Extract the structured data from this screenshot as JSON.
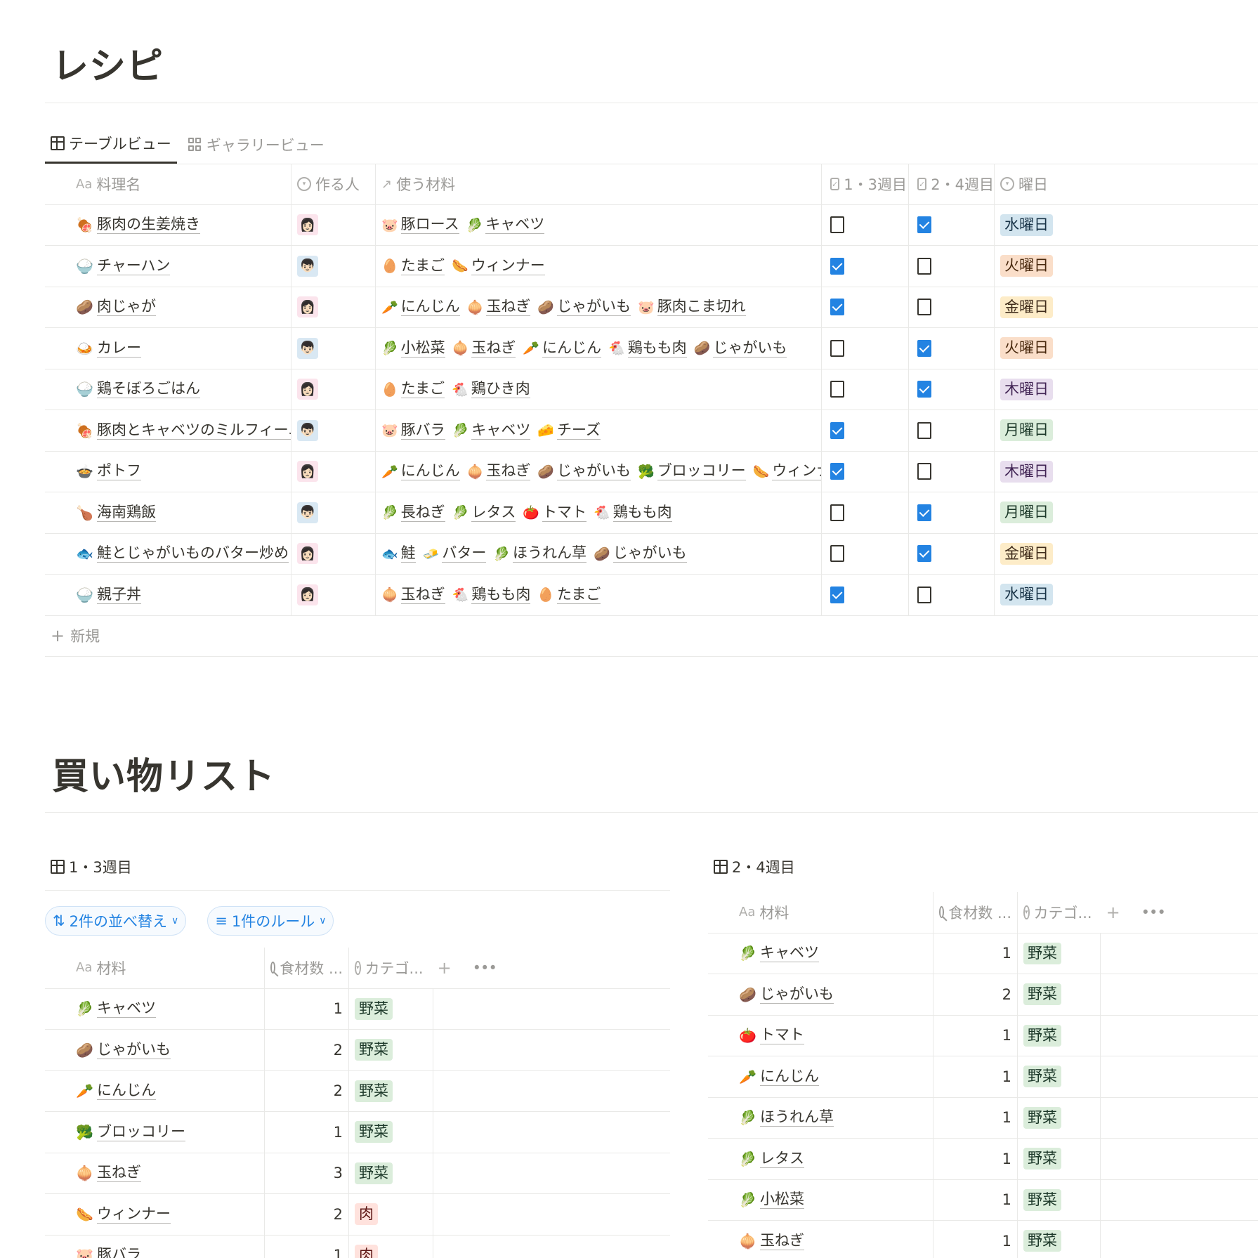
{
  "recipes": {
    "title": "レシピ",
    "tabs": [
      {
        "label": "テーブルビュー",
        "icon": "table-icon",
        "active": true
      },
      {
        "label": "ギャラリービュー",
        "icon": "gallery-icon",
        "active": false
      }
    ],
    "columns": {
      "name": {
        "icon": "Aa",
        "label": "料理名"
      },
      "cook": {
        "label": "作る人"
      },
      "ingredients": {
        "icon": "↗",
        "label": "使う材料"
      },
      "week13": {
        "label": "1・3週目"
      },
      "week24": {
        "label": "2・4週目"
      },
      "day": {
        "label": "曜日"
      }
    },
    "new_label": "新規",
    "rows": [
      {
        "emoji": "🍖",
        "name": "豚肉の生姜焼き",
        "cook": "f",
        "ingredients": [
          [
            "🐷",
            "豚ロース"
          ],
          [
            "🥬",
            "キャベツ"
          ]
        ],
        "w13": false,
        "w24": true,
        "day": "水曜日"
      },
      {
        "emoji": "🍚",
        "name": "チャーハン",
        "cook": "m",
        "ingredients": [
          [
            "🥚",
            "たまご"
          ],
          [
            "🌭",
            "ウィンナー"
          ]
        ],
        "w13": true,
        "w24": false,
        "day": "火曜日"
      },
      {
        "emoji": "🥔",
        "name": "肉じゃが",
        "cook": "f",
        "ingredients": [
          [
            "🥕",
            "にんじん"
          ],
          [
            "🧅",
            "玉ねぎ"
          ],
          [
            "🥔",
            "じゃがいも"
          ],
          [
            "🐷",
            "豚肉こま切れ"
          ]
        ],
        "w13": true,
        "w24": false,
        "day": "金曜日"
      },
      {
        "emoji": "🍛",
        "name": "カレー",
        "cook": "m",
        "ingredients": [
          [
            "🥬",
            "小松菜"
          ],
          [
            "🧅",
            "玉ねぎ"
          ],
          [
            "🥕",
            "にんじん"
          ],
          [
            "🐔",
            "鶏もも肉"
          ],
          [
            "🥔",
            "じゃがいも"
          ]
        ],
        "w13": false,
        "w24": true,
        "day": "火曜日"
      },
      {
        "emoji": "🍚",
        "name": "鶏そぼろごはん",
        "cook": "f",
        "ingredients": [
          [
            "🥚",
            "たまご"
          ],
          [
            "🐔",
            "鶏ひき肉"
          ]
        ],
        "w13": false,
        "w24": true,
        "day": "木曜日"
      },
      {
        "emoji": "🍖",
        "name": "豚肉とキャベツのミルフィーユ",
        "cook": "m",
        "ingredients": [
          [
            "🐷",
            "豚バラ"
          ],
          [
            "🥬",
            "キャベツ"
          ],
          [
            "🧀",
            "チーズ"
          ]
        ],
        "w13": true,
        "w24": false,
        "day": "月曜日"
      },
      {
        "emoji": "🍲",
        "name": "ポトフ",
        "cook": "f",
        "ingredients": [
          [
            "🥕",
            "にんじん"
          ],
          [
            "🧅",
            "玉ねぎ"
          ],
          [
            "🥔",
            "じゃがいも"
          ],
          [
            "🥦",
            "ブロッコリー"
          ],
          [
            "🌭",
            "ウィンナー"
          ]
        ],
        "w13": true,
        "w24": false,
        "day": "木曜日"
      },
      {
        "emoji": "🍗",
        "name": "海南鶏飯",
        "cook": "m",
        "ingredients": [
          [
            "🥬",
            "長ねぎ"
          ],
          [
            "🥬",
            "レタス"
          ],
          [
            "🍅",
            "トマト"
          ],
          [
            "🐔",
            "鶏もも肉"
          ]
        ],
        "w13": false,
        "w24": true,
        "day": "月曜日"
      },
      {
        "emoji": "🐟",
        "name": "鮭とじゃがいものバター炒め",
        "cook": "f",
        "ingredients": [
          [
            "🐟",
            "鮭"
          ],
          [
            "🧈",
            "バター"
          ],
          [
            "🥬",
            "ほうれん草"
          ],
          [
            "🥔",
            "じゃがいも"
          ]
        ],
        "w13": false,
        "w24": true,
        "day": "金曜日"
      },
      {
        "emoji": "🍚",
        "name": "親子丼",
        "cook": "f",
        "ingredients": [
          [
            "🧅",
            "玉ねぎ"
          ],
          [
            "🐔",
            "鶏もも肉"
          ],
          [
            "🥚",
            "たまご"
          ]
        ],
        "w13": true,
        "w24": false,
        "day": "水曜日"
      }
    ],
    "day_colors": {
      "月曜日": {
        "bg": "#dbeddb",
        "fg": "#1c3829"
      },
      "火曜日": {
        "bg": "#fadec9",
        "fg": "#49290e"
      },
      "水曜日": {
        "bg": "#d3e5ef",
        "fg": "#183347"
      },
      "木曜日": {
        "bg": "#e8deee",
        "fg": "#412454"
      },
      "金曜日": {
        "bg": "#fdecc8",
        "fg": "#402c1b"
      }
    }
  },
  "shopping": {
    "title": "買い物リスト",
    "left": {
      "view_title": "1・3週目",
      "sort_label": "2件の並べ替え",
      "filter_label": "1件のルール",
      "columns": {
        "material": "材料",
        "count": "食材数 ...",
        "category": "カテゴ..."
      },
      "rows": [
        {
          "emoji": "🥬",
          "name": "キャベツ",
          "count": "1",
          "category": "野菜"
        },
        {
          "emoji": "🥔",
          "name": "じゃがいも",
          "count": "2",
          "category": "野菜"
        },
        {
          "emoji": "🥕",
          "name": "にんじん",
          "count": "2",
          "category": "野菜"
        },
        {
          "emoji": "🥦",
          "name": "ブロッコリー",
          "count": "1",
          "category": "野菜"
        },
        {
          "emoji": "🧅",
          "name": "玉ねぎ",
          "count": "3",
          "category": "野菜"
        },
        {
          "emoji": "🌭",
          "name": "ウィンナー",
          "count": "2",
          "category": "肉"
        },
        {
          "emoji": "🐷",
          "name": "豚バラ",
          "count": "1",
          "category": "肉"
        }
      ]
    },
    "right": {
      "view_title": "2・4週目",
      "columns": {
        "material": "材料",
        "count": "食材数 ...",
        "category": "カテゴ..."
      },
      "rows": [
        {
          "emoji": "🥬",
          "name": "キャベツ",
          "count": "1",
          "category": "野菜"
        },
        {
          "emoji": "🥔",
          "name": "じゃがいも",
          "count": "2",
          "category": "野菜"
        },
        {
          "emoji": "🍅",
          "name": "トマト",
          "count": "1",
          "category": "野菜"
        },
        {
          "emoji": "🥕",
          "name": "にんじん",
          "count": "1",
          "category": "野菜"
        },
        {
          "emoji": "🥬",
          "name": "ほうれん草",
          "count": "1",
          "category": "野菜"
        },
        {
          "emoji": "🥬",
          "name": "レタス",
          "count": "1",
          "category": "野菜"
        },
        {
          "emoji": "🥬",
          "name": "小松菜",
          "count": "1",
          "category": "野菜"
        },
        {
          "emoji": "🧅",
          "name": "玉ねぎ",
          "count": "1",
          "category": "野菜"
        }
      ]
    },
    "category_colors": {
      "野菜": {
        "bg": "#dbeddb",
        "fg": "#1c3829"
      },
      "肉": {
        "bg": "#ffe2dd",
        "fg": "#5d1715"
      }
    }
  }
}
